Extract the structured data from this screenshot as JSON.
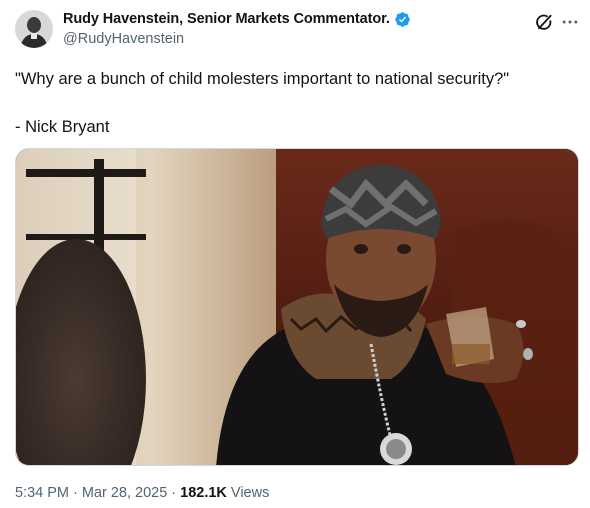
{
  "author": {
    "display_name": "Rudy Havenstein, Senior Markets Commentator.",
    "handle": "@RudyHavenstein",
    "verified": true,
    "avatar_icon": "avatar-portrait"
  },
  "tweet": {
    "text_line1": "\"Why are a bunch of child molesters important to national security?\"",
    "text_line2": "- Nick Bryant"
  },
  "media": {
    "type": "image"
  },
  "meta": {
    "time": "5:34 PM",
    "date": "Mar 28, 2025",
    "views_count": "182.1K",
    "views_label": "Views",
    "separator": "·"
  },
  "icons": {
    "grok": "grok-icon",
    "more": "more-icon",
    "verified": "verified-badge-icon"
  },
  "colors": {
    "text": "#0f1419",
    "secondary": "#536471",
    "verified_blue": "#1d9bf0"
  }
}
